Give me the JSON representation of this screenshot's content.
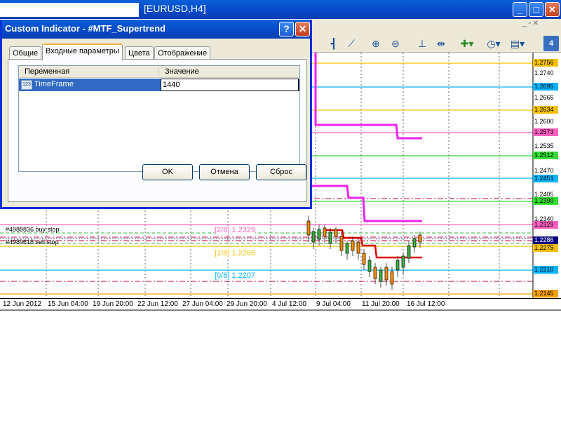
{
  "window": {
    "title": "[EURUSD,H4]"
  },
  "dialog": {
    "title": "Custom Indicator - #MTF_Supertrend",
    "tabs": [
      "Общие",
      "Входные параметры",
      "Цвета",
      "Отображение"
    ],
    "active_tab": "Входные параметры",
    "grid": {
      "headers": [
        "Переменная",
        "Значение"
      ],
      "rows": [
        {
          "icon": "123",
          "variable": "TimeFrame",
          "value": "1440"
        }
      ]
    },
    "buttons": {
      "ok": "OK",
      "cancel": "Отмена",
      "reset": "Сброс"
    }
  },
  "chart": {
    "symbol": "EURUSD",
    "timeframe": "H4",
    "price_labels": [
      {
        "text": "1.2756",
        "color": "#f5c000"
      },
      {
        "text": "1.2695",
        "color": "#00b4ff"
      },
      {
        "text": "1.2634",
        "color": "#f5c000"
      },
      {
        "text": "1.2573",
        "color": "#ff60c0"
      },
      {
        "text": "1.2512",
        "color": "#33dd33"
      },
      {
        "text": "1.2451",
        "color": "#00b4ff"
      },
      {
        "text": "1.2390",
        "color": "#33dd33"
      },
      {
        "text": "1.2329",
        "color": "#ff60c0"
      },
      {
        "text": "1.2286",
        "color": "#000080"
      },
      {
        "text": "1.2275",
        "color": "#f5c000"
      },
      {
        "text": "1.2210",
        "color": "#00b4ff"
      },
      {
        "text": "1.2145",
        "color": "#f5a000"
      }
    ],
    "price_ticks": [
      "1.2740",
      "1.2665",
      "1.2600",
      "1.2535",
      "1.2470",
      "1.2405",
      "1.2340"
    ],
    "fibo_labels": [
      {
        "text": "[2/8]  1.2329",
        "color": "#ff60c0"
      },
      {
        "text": "[1/8]  1.2268",
        "color": "#f5c000"
      },
      {
        "text": "[0/8]  1.2207",
        "color": "#00b4ff"
      }
    ],
    "order_labels": [
      "#4988836 buy stop",
      "#4989618 sell stop"
    ],
    "time_labels": [
      "12 Jun 2012",
      "15 Jun 04:00",
      "19 Jun 20:00",
      "22 Jun 12:00",
      "27 Jun 04:00",
      "29 Jun 20:00",
      "4 Jul 12:00",
      "9 Jul 04:00",
      "11 Jul 20:00",
      "16 Jul 12:00"
    ]
  },
  "toolbar": {
    "icons": [
      "bar-chart-icon",
      "candle-chart-icon",
      "line-chart-icon",
      "zoom-in-icon",
      "zoom-out-icon",
      "tile-icon",
      "autoscroll-icon",
      "indicators-icon",
      "period-icon",
      "templates-icon"
    ]
  }
}
